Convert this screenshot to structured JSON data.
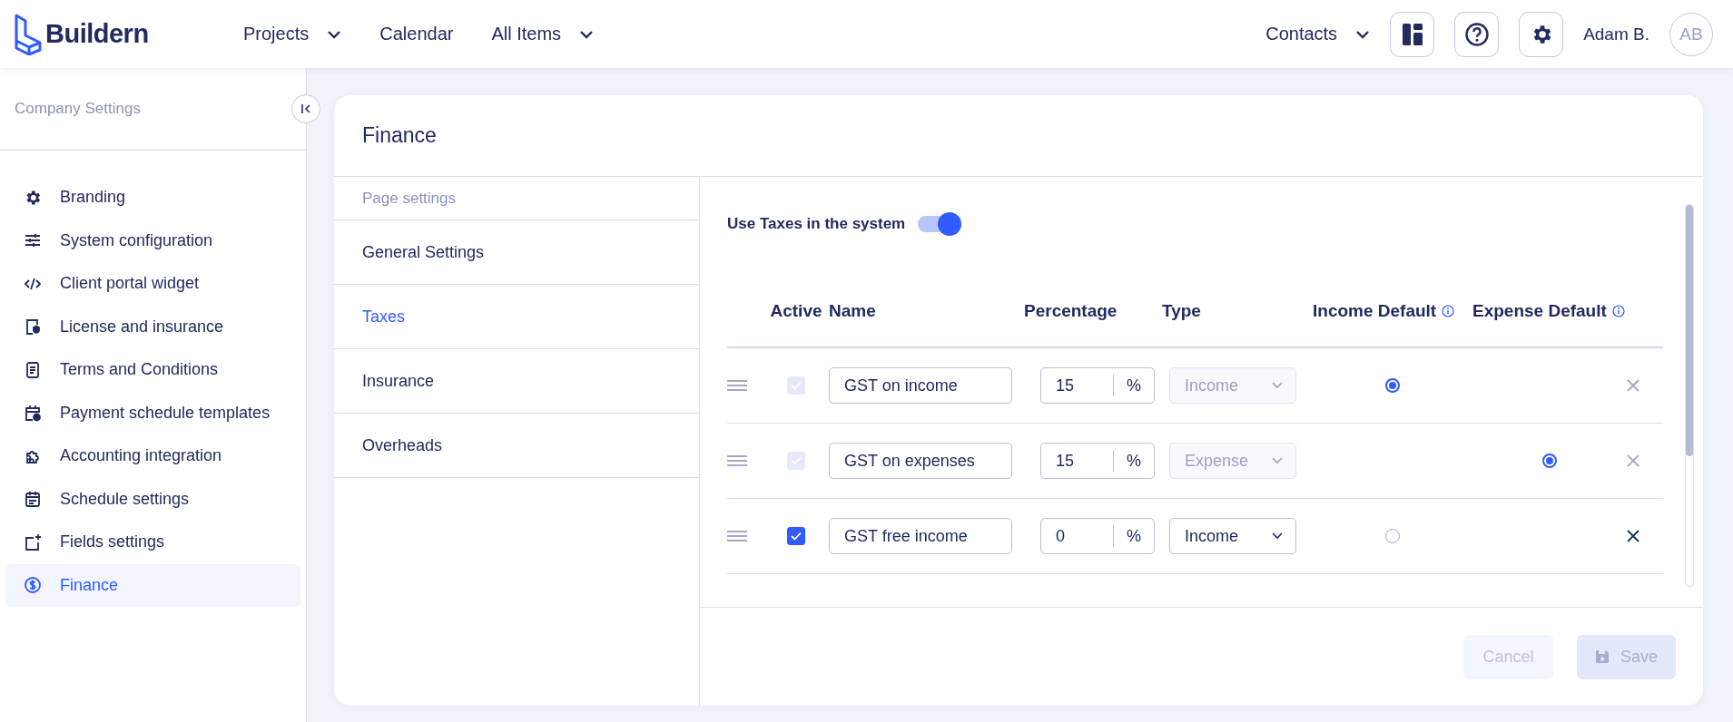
{
  "header": {
    "logo": "Buildern",
    "nav": [
      {
        "label": "Projects",
        "dropdown": true
      },
      {
        "label": "Calendar",
        "dropdown": false
      },
      {
        "label": "All Items",
        "dropdown": true
      }
    ],
    "contacts": "Contacts",
    "user_name": "Adam B.",
    "avatar": "AB"
  },
  "sidebar": {
    "title": "Company Settings",
    "items": [
      {
        "label": "Branding",
        "selected": false
      },
      {
        "label": "System configuration",
        "selected": false
      },
      {
        "label": "Client portal widget",
        "selected": false
      },
      {
        "label": "License and insurance",
        "selected": false
      },
      {
        "label": "Terms and Conditions",
        "selected": false
      },
      {
        "label": "Payment schedule templates",
        "selected": false
      },
      {
        "label": "Accounting integration",
        "selected": false
      },
      {
        "label": "Schedule settings",
        "selected": false
      },
      {
        "label": "Fields settings",
        "selected": false
      },
      {
        "label": "Finance",
        "selected": true
      }
    ]
  },
  "page": {
    "title": "Finance",
    "settings_heading": "Page settings",
    "tabs": [
      {
        "label": "General Settings",
        "selected": false
      },
      {
        "label": "Taxes",
        "selected": true
      },
      {
        "label": "Insurance",
        "selected": false
      },
      {
        "label": "Overheads",
        "selected": false
      }
    ],
    "use_taxes": {
      "label": "Use Taxes in the system",
      "on": true
    },
    "table": {
      "columns": [
        "Active",
        "Name",
        "Percentage",
        "Type",
        "Income Default",
        "Expense Default"
      ],
      "rows": [
        {
          "active": true,
          "disabled": true,
          "name": "GST on income",
          "percentage": "15",
          "unit": "%",
          "type": "Income",
          "kind": "income",
          "default": true
        },
        {
          "active": true,
          "disabled": true,
          "name": "GST on expenses",
          "percentage": "15",
          "unit": "%",
          "type": "Expense",
          "kind": "expense",
          "default": true
        },
        {
          "active": true,
          "disabled": false,
          "name": "GST free income",
          "percentage": "0",
          "unit": "%",
          "type": "Income",
          "kind": "income",
          "default": false
        }
      ]
    },
    "buttons": [
      {
        "label": "Cancel",
        "kind": "cancel",
        "disabled": true
      },
      {
        "label": "Save",
        "kind": "save",
        "disabled": true
      }
    ]
  }
}
